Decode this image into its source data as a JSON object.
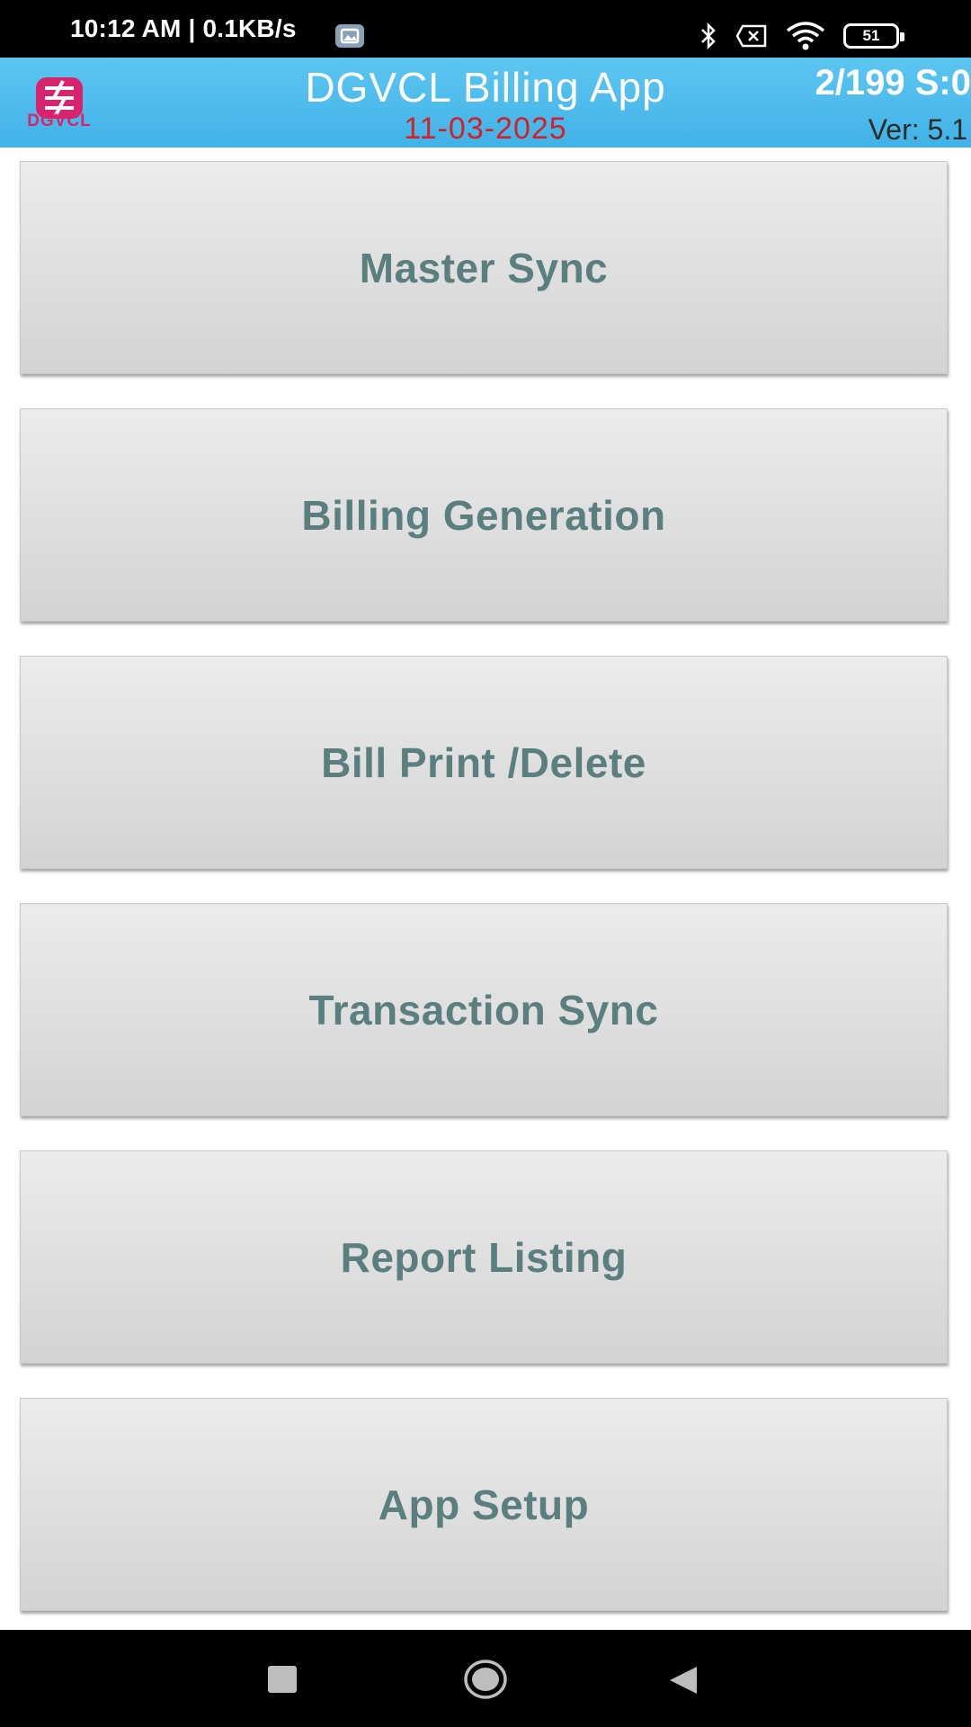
{
  "status_bar": {
    "time": "10:12 AM | 0.1KB/s",
    "icons": [
      "gallery-icon",
      "bluetooth-icon",
      "sim-disabled-icon",
      "wifi-icon",
      "battery-icon"
    ],
    "battery_level": "51"
  },
  "header": {
    "logo_text": "DGVCL",
    "title": "DGVCL Billing App",
    "date": "11-03-2025",
    "counter": "2/199 S:0",
    "version": "Ver: 5.1"
  },
  "menu": [
    {
      "label": "Master Sync"
    },
    {
      "label": "Billing Generation"
    },
    {
      "label": "Bill Print /Delete"
    },
    {
      "label": "Transaction Sync"
    },
    {
      "label": "Report Listing"
    },
    {
      "label": "App Setup"
    }
  ],
  "nav": {
    "icons": [
      "recents-icon",
      "home-icon",
      "back-icon"
    ]
  },
  "colors": {
    "header_bg": "#41b2e6",
    "date_text": "#d3202a",
    "button_text": "#5b7f7f",
    "logo": "#d8236f"
  }
}
